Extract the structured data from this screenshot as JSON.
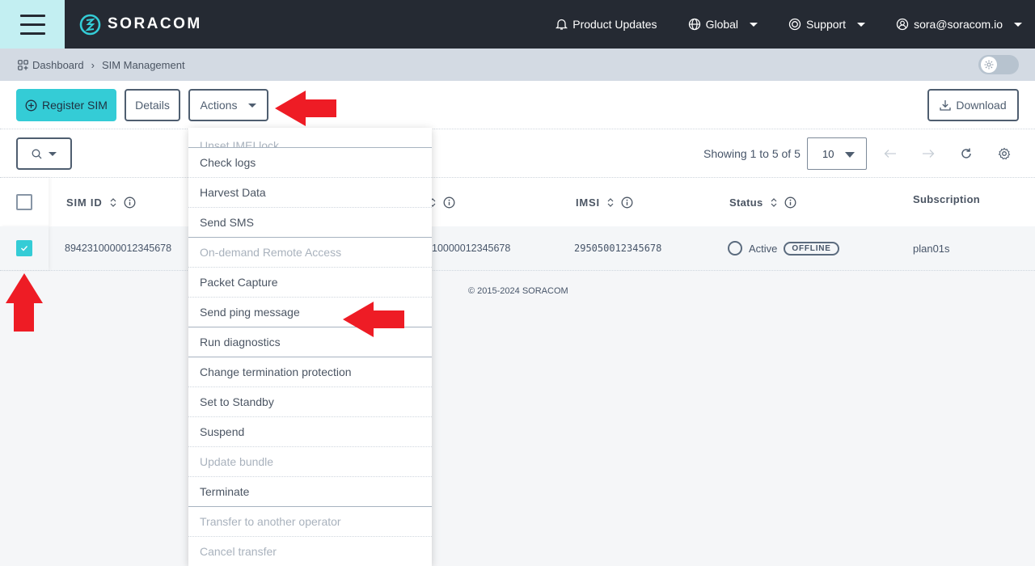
{
  "header": {
    "brand": "SORACOM",
    "nav": [
      {
        "label": "Product Updates",
        "icon": "bell-icon",
        "has_caret": false
      },
      {
        "label": "Global",
        "icon": "globe-icon",
        "has_caret": true
      },
      {
        "label": "Support",
        "icon": "lifebuoy-icon",
        "has_caret": true
      },
      {
        "label": "sora@soracom.io",
        "icon": "user-icon",
        "has_caret": true
      }
    ]
  },
  "breadcrumb": {
    "items": [
      "Dashboard",
      "SIM Management"
    ],
    "theme_toggle": "light"
  },
  "toolbar": {
    "register_label": "Register SIM",
    "details_label": "Details",
    "actions_label": "Actions",
    "download_label": "Download"
  },
  "filter": {
    "showing": "Showing 1 to 5 of 5",
    "per_page": "10"
  },
  "table": {
    "columns": [
      "SIM ID",
      "",
      "IMSI",
      "Status",
      "Subscription"
    ],
    "rows": [
      {
        "checked": true,
        "sim_id": "8942310000012345678",
        "iccid_partial": "10000012345678",
        "imsi": "295050012345678",
        "status": "Active",
        "online": "OFFLINE",
        "subscription": "plan01s"
      }
    ]
  },
  "footer": "© 2015-2024 SORACOM",
  "actions_menu": [
    {
      "label": "Unset IMEI lock",
      "disabled": true,
      "group_end": true
    },
    {
      "label": "Check logs",
      "disabled": false,
      "group_end": false
    },
    {
      "label": "Harvest Data",
      "disabled": false,
      "group_end": false
    },
    {
      "label": "Send SMS",
      "disabled": false,
      "group_end": true
    },
    {
      "label": "On-demand Remote Access",
      "disabled": true,
      "group_end": false
    },
    {
      "label": "Packet Capture",
      "disabled": false,
      "group_end": false
    },
    {
      "label": "Send ping message",
      "disabled": false,
      "group_end": true
    },
    {
      "label": "Run diagnostics",
      "disabled": false,
      "group_end": true
    },
    {
      "label": "Change termination protection",
      "disabled": false,
      "group_end": false
    },
    {
      "label": "Set to Standby",
      "disabled": false,
      "group_end": false
    },
    {
      "label": "Suspend",
      "disabled": false,
      "group_end": false
    },
    {
      "label": "Update bundle",
      "disabled": true,
      "group_end": false
    },
    {
      "label": "Terminate",
      "disabled": false,
      "group_end": true
    },
    {
      "label": "Transfer to another operator",
      "disabled": true,
      "group_end": false
    },
    {
      "label": "Cancel transfer",
      "disabled": true,
      "group_end": false
    }
  ],
  "colors": {
    "topbar": "#252a33",
    "accent": "#34ccd6",
    "annotation_arrow": "#ee1c25"
  }
}
